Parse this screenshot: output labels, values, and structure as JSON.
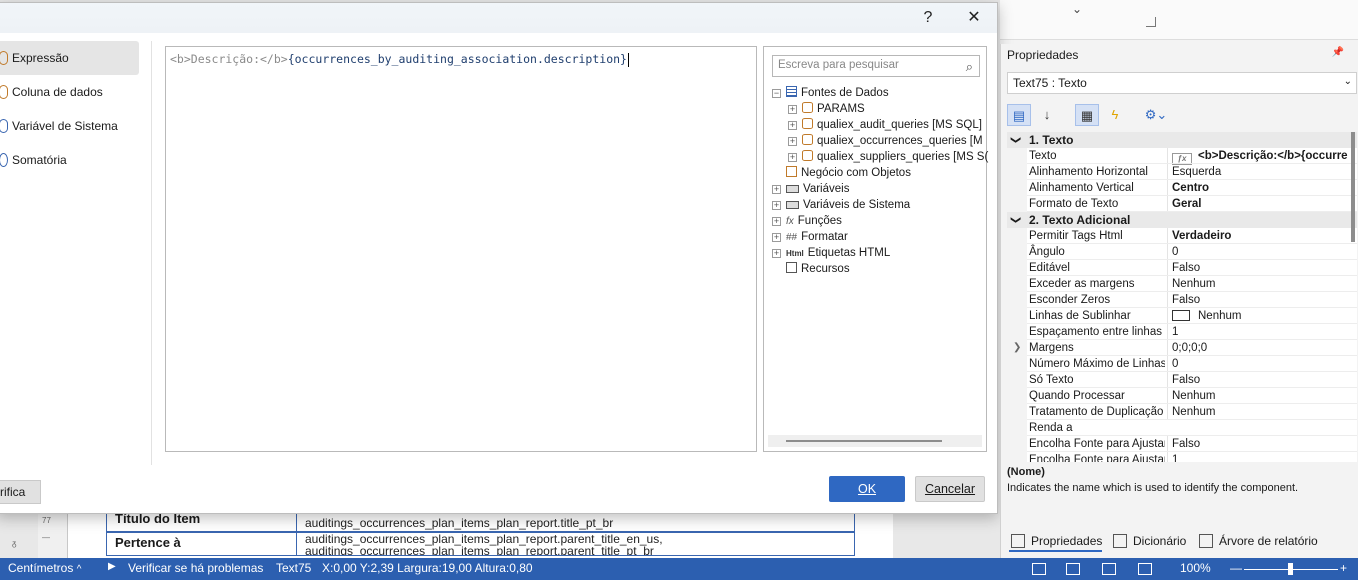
{
  "dialog": {
    "help_glyph": "?",
    "close_glyph": "✕",
    "categories": [
      {
        "label": "Expressão",
        "selected": true
      },
      {
        "label": "Coluna de dados",
        "selected": false
      },
      {
        "label": "Variável de Sistema",
        "selected": false
      },
      {
        "label": "Somatória",
        "selected": false
      }
    ],
    "expression": {
      "tag_open": "<b>Descrição:</b>",
      "field": "{occurrences_by_auditing_association.description}"
    },
    "search_placeholder": "Escreva para pesquisar",
    "tree": {
      "root": "Fontes de Dados",
      "sources": [
        "PARAMS",
        "qualiex_audit_queries [MS SQL]",
        "qualiex_occurrences_queries [M",
        "qualiex_suppliers_queries [MS S("
      ],
      "business_objects": "Negócio com Objetos",
      "variables": "Variáveis",
      "system_variables": "Variáveis de Sistema",
      "functions": "Funções",
      "format": "Formatar",
      "html_tags": "Etiquetas HTML",
      "resources": "Recursos",
      "fx_glyph": "fx",
      "format_glyph": "##",
      "html_glyph": "Html"
    },
    "ok_label": "OK",
    "cancel_label": "Cancelar",
    "verify_label": "rifica"
  },
  "report": {
    "ruler_numbers": [
      "77",
      "—",
      "ᵹ"
    ],
    "rows": [
      {
        "label": "Título do Item",
        "value_line1": "",
        "value_line2": "auditings_occurrences_plan_items_plan_report.title_pt_br"
      },
      {
        "label": "Pertence à",
        "value_line1": "auditings_occurrences_plan_items_plan_report.parent_title_en_us,",
        "value_line2": "auditings_occurrences_plan_items_plan_report.parent_title_pt_br"
      }
    ],
    "top_chevron": "⌄"
  },
  "properties": {
    "title": "Propriedades",
    "pin": "📌",
    "selected_component": "Text75 : Texto",
    "categories": [
      {
        "name": "1. Texto",
        "rows": [
          {
            "name": "Texto",
            "value": "<b>Descrição:</b>{occurre",
            "bold": true,
            "fx": true
          },
          {
            "name": "Alinhamento Horizontal",
            "value": "Esquerda"
          },
          {
            "name": "Alinhamento Vertical",
            "value": "Centro",
            "bold": true
          },
          {
            "name": "Formato de Texto",
            "value": "Geral",
            "bold": true
          }
        ]
      },
      {
        "name": "2. Texto  Adicional",
        "rows": [
          {
            "name": "Permitir Tags Html",
            "value": "Verdadeiro",
            "bold": true
          },
          {
            "name": "Ângulo",
            "value": "0"
          },
          {
            "name": "Editável",
            "value": "Falso"
          },
          {
            "name": "Exceder as margens",
            "value": "Nenhum"
          },
          {
            "name": "Esconder Zeros",
            "value": "Falso"
          },
          {
            "name": "Linhas de Sublinhar",
            "value": "Nenhum",
            "color_box": true
          },
          {
            "name": "Espaçamento entre linhas",
            "value": "1"
          },
          {
            "name": "Margens",
            "value": "0;0;0;0",
            "expandable": true
          },
          {
            "name": "Número Máximo de Linhas",
            "value": "0"
          },
          {
            "name": "Só Texto",
            "value": "Falso"
          },
          {
            "name": "Quando Processar",
            "value": "Nenhum"
          },
          {
            "name": "Tratamento de Duplicação",
            "value": "Nenhum"
          },
          {
            "name": "Renda a",
            "value": ""
          },
          {
            "name": "Encolha Fonte para Ajustar",
            "value": "Falso"
          },
          {
            "name": "Encolha Fonte para Ajustar",
            "value": "1"
          }
        ]
      }
    ],
    "description_title": "(Nome)",
    "description_text": "Indicates the name which is used to identify the component.",
    "tabs": [
      "Propriedades",
      "Dicionário",
      "Árvore de relatório"
    ]
  },
  "statusbar": {
    "units": "Centímetros",
    "verify": "Verificar se há problemas",
    "component": "Text75",
    "position": "X:0,00  Y:2,39  Largura:19,00  Altura:0,80",
    "zoom": "100%",
    "zoom_minus": "—",
    "zoom_plus": "+",
    "units_caret": "^"
  },
  "colors": {
    "accent": "#2f68c2",
    "statusbar": "#2c5fb0"
  }
}
